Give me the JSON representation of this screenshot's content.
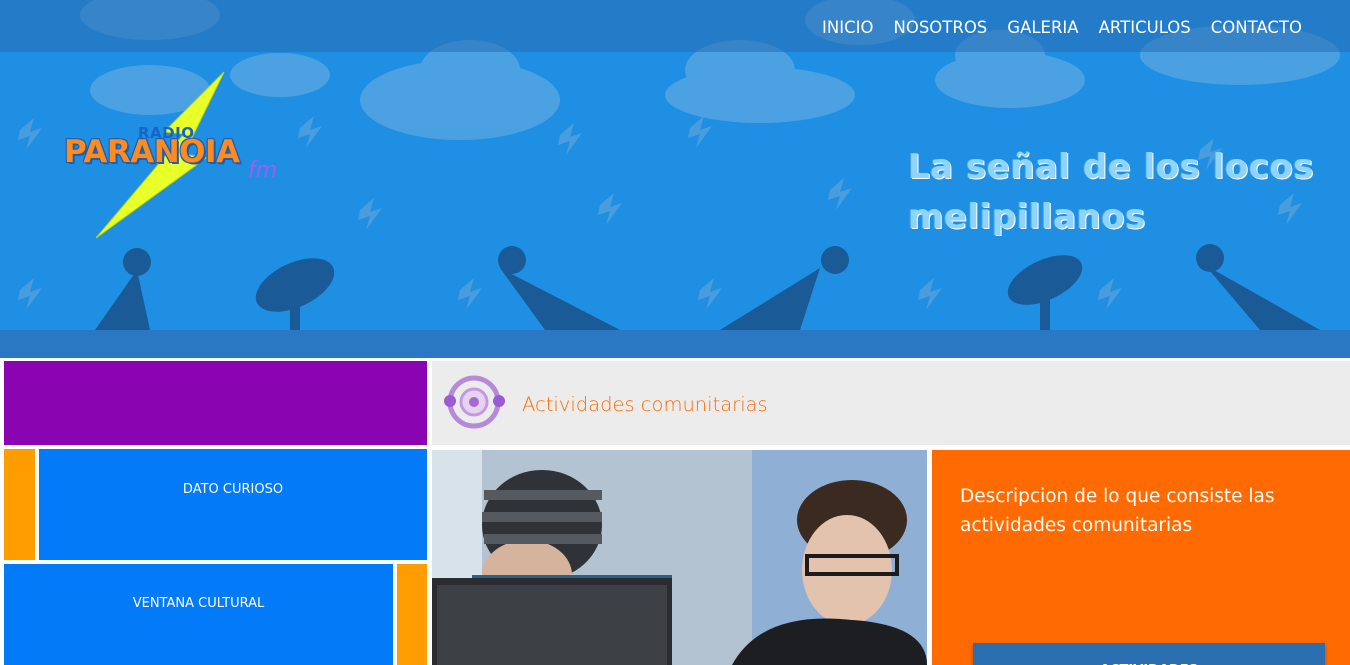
{
  "nav": {
    "items": [
      {
        "label": "INICIO"
      },
      {
        "label": "NOSOTROS"
      },
      {
        "label": "GALERIA"
      },
      {
        "label": "ARTICULOS"
      },
      {
        "label": "CONTACTO"
      }
    ]
  },
  "logo": {
    "top_text": "RADIO",
    "name": "PARANOIA",
    "suffix": "fm",
    "icon": "lightning-bolt-icon"
  },
  "slogan": "La señal de los locos melipillanos",
  "tiles": {
    "dato_label": "DATO CURIOSO",
    "ventana_label": "VENTANA CULTURAL"
  },
  "activity": {
    "title": "Actividades comunitarias",
    "icon": "radio-signal-icon",
    "description": "Descripcion de lo que consiste las actividades comunitarias",
    "button_label": "ACTIVIDADES"
  },
  "colors": {
    "header_blue": "#1f8fe3",
    "purple": "#8a04b1",
    "tile_blue": "#037af8",
    "accent_orange": "#ff9d00",
    "desc_orange": "#ff6b00",
    "title_orange": "#ff6b00",
    "panel_gray": "#ececec"
  }
}
